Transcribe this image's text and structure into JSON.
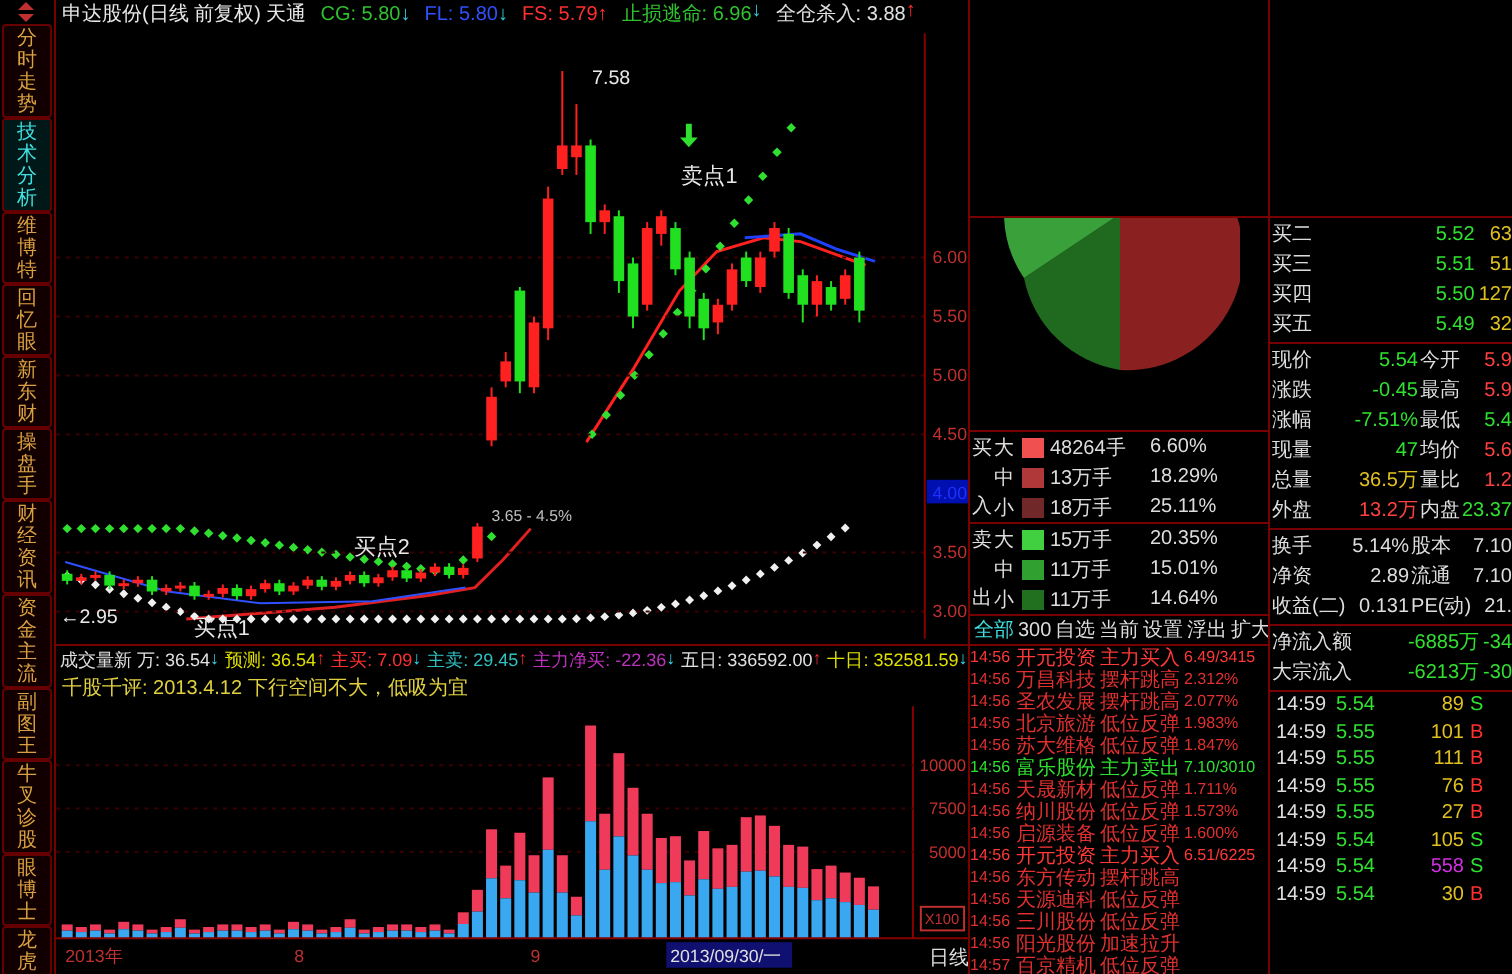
{
  "side_tabs": [
    {
      "label": "分时走势",
      "selected": false
    },
    {
      "label": "技术分析",
      "selected": true
    },
    {
      "label": "维博特",
      "selected": false
    },
    {
      "label": "回忆眼",
      "selected": false
    },
    {
      "label": "新东财",
      "selected": false
    },
    {
      "label": "操盘手",
      "selected": false
    },
    {
      "label": "财经资讯",
      "selected": false
    },
    {
      "label": "资金主流",
      "selected": false
    },
    {
      "label": "副图王",
      "selected": false
    },
    {
      "label": "牛叉诊股",
      "selected": false
    },
    {
      "label": "眼博士",
      "selected": false
    },
    {
      "label": "龙虎",
      "selected": false
    }
  ],
  "chart_header": {
    "title": "申达股份(日线 前复权) 天通",
    "readings": [
      {
        "label": "CG: 5.80",
        "arrow": "↓",
        "kind": "down",
        "color": "#30c030"
      },
      {
        "label": "FL: 5.80",
        "arrow": "↓",
        "kind": "down",
        "color": "#3050ff"
      },
      {
        "label": "FS: 5.79",
        "arrow": "↑",
        "kind": "up",
        "color": "#ff3030"
      },
      {
        "label": "止损逃命: 6.96",
        "arrow": "↓",
        "kind": "down",
        "color": "#30c030"
      },
      {
        "label": "全仓杀入: 3.88",
        "arrow": "↑",
        "kind": "up",
        "color": "#e0e0e0"
      }
    ]
  },
  "price_chart": {
    "cursor_label": "4.00",
    "chart_data": {
      "type": "candlestick",
      "grid": true,
      "ylim": [
        2.77,
        7.9
      ],
      "ohlc": [
        [
          3.32,
          3.35,
          3.23,
          3.26
        ],
        [
          3.26,
          3.32,
          3.23,
          3.29
        ],
        [
          3.29,
          3.34,
          3.26,
          3.31
        ],
        [
          3.31,
          3.34,
          3.19,
          3.22
        ],
        [
          3.22,
          3.27,
          3.19,
          3.24
        ],
        [
          3.24,
          3.3,
          3.21,
          3.27
        ],
        [
          3.27,
          3.3,
          3.14,
          3.17
        ],
        [
          3.17,
          3.23,
          3.14,
          3.2
        ],
        [
          3.2,
          3.25,
          3.17,
          3.22
        ],
        [
          3.22,
          3.25,
          3.1,
          3.13
        ],
        [
          3.13,
          3.18,
          3.1,
          3.15
        ],
        [
          3.15,
          3.23,
          3.12,
          3.2
        ],
        [
          3.2,
          3.23,
          3.1,
          3.13
        ],
        [
          3.13,
          3.22,
          3.1,
          3.19
        ],
        [
          3.19,
          3.27,
          3.16,
          3.24
        ],
        [
          3.24,
          3.27,
          3.14,
          3.17
        ],
        [
          3.17,
          3.25,
          3.14,
          3.22
        ],
        [
          3.22,
          3.3,
          3.19,
          3.27
        ],
        [
          3.27,
          3.3,
          3.18,
          3.21
        ],
        [
          3.21,
          3.29,
          3.18,
          3.26
        ],
        [
          3.26,
          3.34,
          3.23,
          3.31
        ],
        [
          3.31,
          3.34,
          3.21,
          3.24
        ],
        [
          3.24,
          3.32,
          3.21,
          3.29
        ],
        [
          3.29,
          3.38,
          3.26,
          3.35
        ],
        [
          3.35,
          3.38,
          3.25,
          3.28
        ],
        [
          3.28,
          3.36,
          3.25,
          3.33
        ],
        [
          3.33,
          3.41,
          3.3,
          3.38
        ],
        [
          3.38,
          3.41,
          3.28,
          3.31
        ],
        [
          3.31,
          3.4,
          3.28,
          3.37
        ],
        [
          3.45,
          3.75,
          3.42,
          3.72
        ],
        [
          4.45,
          4.9,
          4.4,
          4.82
        ],
        [
          4.95,
          5.2,
          4.9,
          5.12
        ],
        [
          5.72,
          5.75,
          4.85,
          4.95
        ],
        [
          4.9,
          5.5,
          4.85,
          5.45
        ],
        [
          5.4,
          6.6,
          5.3,
          6.5
        ],
        [
          6.75,
          7.58,
          6.7,
          6.95
        ],
        [
          6.85,
          7.3,
          6.7,
          6.95
        ],
        [
          6.95,
          7.0,
          6.2,
          6.3
        ],
        [
          6.3,
          6.45,
          6.2,
          6.4
        ],
        [
          6.35,
          6.4,
          5.7,
          5.8
        ],
        [
          5.95,
          6.0,
          5.4,
          5.5
        ],
        [
          5.6,
          6.3,
          5.55,
          6.25
        ],
        [
          6.2,
          6.4,
          6.1,
          6.35
        ],
        [
          6.25,
          6.3,
          5.85,
          5.9
        ],
        [
          6.0,
          6.05,
          5.4,
          5.5
        ],
        [
          5.65,
          5.7,
          5.3,
          5.4
        ],
        [
          5.45,
          5.65,
          5.35,
          5.6
        ],
        [
          5.6,
          5.95,
          5.55,
          5.9
        ],
        [
          6.0,
          6.05,
          5.75,
          5.8
        ],
        [
          5.75,
          6.05,
          5.7,
          6.0
        ],
        [
          6.05,
          6.3,
          6.0,
          6.25
        ],
        [
          6.2,
          6.25,
          5.65,
          5.7
        ],
        [
          5.85,
          5.9,
          5.45,
          5.6
        ],
        [
          5.6,
          5.85,
          5.5,
          5.8
        ],
        [
          5.75,
          5.8,
          5.55,
          5.6
        ],
        [
          5.65,
          5.9,
          5.6,
          5.85
        ],
        [
          6.0,
          6.05,
          5.45,
          5.55
        ]
      ],
      "yticks": [
        {
          "value": 6,
          "label": "6.00"
        },
        {
          "value": 5.5,
          "label": "5.50"
        },
        {
          "value": 5,
          "label": "5.00"
        },
        {
          "value": 4.5,
          "label": "4.50"
        },
        {
          "value": 3.5,
          "label": "3.50"
        },
        {
          "value": 3,
          "label": "3.00"
        }
      ]
    },
    "annotations": [
      {
        "kind": "peak",
        "text": "7.58"
      },
      {
        "kind": "signal",
        "text": "卖点1"
      },
      {
        "kind": "signal",
        "text": "买点2"
      },
      {
        "kind": "note",
        "text": "3.65 - 4.5%"
      },
      {
        "kind": "low",
        "text": "←2.95"
      },
      {
        "kind": "signal",
        "text": "买点1"
      }
    ]
  },
  "volume_header": {
    "readings": [
      {
        "label": "成交量新 万: 36.54",
        "arrow": "↓",
        "kind": "down",
        "color": "#e0e0e0"
      },
      {
        "label": "预测: 36.54",
        "arrow": "↑",
        "kind": "up",
        "color": "#e0e000"
      },
      {
        "label": "主买: 7.09",
        "arrow": "↓",
        "kind": "down",
        "color": "#ff3030"
      },
      {
        "label": "主卖: 29.45",
        "arrow": "↑",
        "kind": "up",
        "color": "#30c0c0"
      },
      {
        "label": "主力净买: -22.36",
        "arrow": "↓",
        "kind": "down",
        "color": "#c030c0"
      },
      {
        "label": "五日: 336592.00",
        "arrow": "↑",
        "kind": "up",
        "color": "#e0e0e0"
      },
      {
        "label": "十日: 352581.59",
        "arrow": "↓",
        "kind": "down",
        "color": "#e0e000"
      }
    ],
    "comment": "千股千评: 2013.4.12 下行空间不大，低吸为宜"
  },
  "volume_chart": {
    "axis_labels": [
      "10000",
      "7500",
      "5000"
    ],
    "unit": "X100",
    "period": "日线",
    "dates": [
      {
        "text": "2013年",
        "kind": "tick"
      },
      {
        "text": "8",
        "kind": "tick"
      },
      {
        "text": "9",
        "kind": "tick"
      },
      {
        "text": "2013/09/30/一",
        "kind": "cursor"
      }
    ]
  },
  "fund_flow": {
    "groups": [
      {
        "label_top": "买",
        "label_bottom": "入",
        "rows": [
          {
            "size": "大",
            "amount": "48264手",
            "share": "6.60%",
            "color": "#f05050"
          },
          {
            "size": "中",
            "amount": "13万手",
            "share": "18.29%",
            "color": "#b03838"
          },
          {
            "size": "小",
            "amount": "18万手",
            "share": "25.11%",
            "color": "#702828"
          }
        ]
      },
      {
        "label_top": "卖",
        "label_bottom": "出",
        "rows": [
          {
            "size": "大",
            "amount": "15万手",
            "share": "20.35%",
            "color": "#40d040"
          },
          {
            "size": "中",
            "amount": "11万手",
            "share": "15.01%",
            "color": "#30a030"
          },
          {
            "size": "小",
            "amount": "11万手",
            "share": "14.64%",
            "color": "#207020"
          }
        ]
      }
    ],
    "tabs": [
      {
        "label": "全部",
        "selected": true
      },
      {
        "label": "300",
        "selected": false
      },
      {
        "label": "自选",
        "selected": false
      },
      {
        "label": "当前",
        "selected": false
      },
      {
        "label": "设置",
        "selected": false
      },
      {
        "label": "浮出",
        "selected": false
      },
      {
        "label": "扩大",
        "selected": false
      }
    ]
  },
  "alerts": [
    {
      "time": "14:56",
      "name": "开元投资",
      "signal": "主力买入",
      "value": "6.49/3415",
      "kind": "buy"
    },
    {
      "time": "14:56",
      "name": "万昌科技",
      "signal": "摆杆跳高",
      "value": "2.312%",
      "kind": "pattern"
    },
    {
      "time": "14:56",
      "name": "圣农发展",
      "signal": "摆杆跳高",
      "value": "2.077%",
      "kind": "pattern"
    },
    {
      "time": "14:56",
      "name": "北京旅游",
      "signal": "低位反弹",
      "value": "1.983%",
      "kind": "pattern"
    },
    {
      "time": "14:56",
      "name": "苏大维格",
      "signal": "低位反弹",
      "value": "1.847%",
      "kind": "pattern"
    },
    {
      "time": "14:56",
      "name": "富乐股份",
      "signal": "主力卖出",
      "value": "7.10/3010",
      "kind": "sell"
    },
    {
      "time": "14:56",
      "name": "天晟新材",
      "signal": "低位反弹",
      "value": "1.711%",
      "kind": "pattern"
    },
    {
      "time": "14:56",
      "name": "纳川股份",
      "signal": "低位反弹",
      "value": "1.573%",
      "kind": "pattern"
    },
    {
      "time": "14:56",
      "name": "启源装备",
      "signal": "低位反弹",
      "value": "1.600%",
      "kind": "pattern"
    },
    {
      "time": "14:56",
      "name": "开元投资",
      "signal": "主力买入",
      "value": "6.51/6225",
      "kind": "buy"
    },
    {
      "time": "14:56",
      "name": "东方传动",
      "signal": "摆杆跳高",
      "kind": "pattern"
    },
    {
      "time": "14:56",
      "name": "天源迪科",
      "signal": "低位反弹",
      "kind": "pattern"
    },
    {
      "time": "14:56",
      "name": "三川股份",
      "signal": "低位反弹",
      "kind": "pattern"
    },
    {
      "time": "14:56",
      "name": "阳光股份",
      "signal": "加速拉升",
      "kind": "pattern"
    },
    {
      "time": "14:57",
      "name": "百京精机",
      "signal": "低位反弹",
      "kind": "pattern"
    }
  ],
  "quote": {
    "order_book": [
      {
        "label": "买二",
        "price": "5.52",
        "volume": "63"
      },
      {
        "label": "买三",
        "price": "5.51",
        "volume": "51"
      },
      {
        "label": "买四",
        "price": "5.50",
        "volume": "127"
      },
      {
        "label": "买五",
        "price": "5.49",
        "volume": "32"
      }
    ],
    "stats": [
      {
        "label": "现价",
        "value": "5.54",
        "kind": "fall"
      },
      {
        "label": "今开",
        "value": "5.9",
        "kind": "rise"
      },
      {
        "label": "涨跌",
        "value": "-0.45",
        "kind": "fall"
      },
      {
        "label": "最高",
        "value": "5.9",
        "kind": "rise"
      },
      {
        "label": "涨幅",
        "value": "-7.51%",
        "kind": "fall"
      },
      {
        "label": "最低",
        "value": "5.4",
        "kind": "fall"
      },
      {
        "label": "现量",
        "value": "47",
        "kind": "fall"
      },
      {
        "label": "均价",
        "value": "5.6",
        "kind": "rise"
      },
      {
        "label": "总量",
        "value": "36.5万",
        "kind": "volume"
      },
      {
        "label": "量比",
        "value": "1.2",
        "kind": "rise"
      },
      {
        "label": "外盘",
        "value": "13.2万",
        "kind": "rise"
      },
      {
        "label": "内盘",
        "value": "23.37",
        "kind": "fall"
      }
    ],
    "shares": [
      {
        "label": "换手",
        "value": "5.14%",
        "label_2": "股本",
        "value_2": "7.10"
      },
      {
        "label": "净资",
        "value": "2.89",
        "label_2": "流通",
        "value_2": "7.10"
      },
      {
        "label": "收益(二)",
        "value": "0.131",
        "label_2": "PE(动)",
        "value_2": "21."
      }
    ],
    "flows": [
      {
        "label": "净流入额",
        "value": "-6885万",
        "value_2": "-34"
      },
      {
        "label": "大宗流入",
        "value": "-6213万",
        "value_2": "-30"
      }
    ]
  },
  "ticks": [
    {
      "time": "14:59",
      "price": "5.54",
      "volume": "89",
      "side": "S",
      "kind": "sell",
      "highlighted": false
    },
    {
      "time": "14:59",
      "price": "5.55",
      "volume": "101",
      "side": "B",
      "kind": "buy",
      "highlighted": false
    },
    {
      "time": "14:59",
      "price": "5.55",
      "volume": "111",
      "side": "B",
      "kind": "buy",
      "highlighted": false
    },
    {
      "time": "14:59",
      "price": "5.55",
      "volume": "76",
      "side": "B",
      "kind": "buy",
      "highlighted": false
    },
    {
      "time": "14:59",
      "price": "5.55",
      "volume": "27",
      "side": "B",
      "kind": "buy",
      "highlighted": false
    },
    {
      "time": "14:59",
      "price": "5.54",
      "volume": "105",
      "side": "S",
      "kind": "sell",
      "highlighted": false
    },
    {
      "time": "14:59",
      "price": "5.54",
      "volume": "558",
      "side": "S",
      "kind": "sell",
      "highlighted": true
    },
    {
      "time": "14:59",
      "price": "5.54",
      "volume": "30",
      "side": "B",
      "kind": "buy",
      "highlighted": false
    }
  ]
}
